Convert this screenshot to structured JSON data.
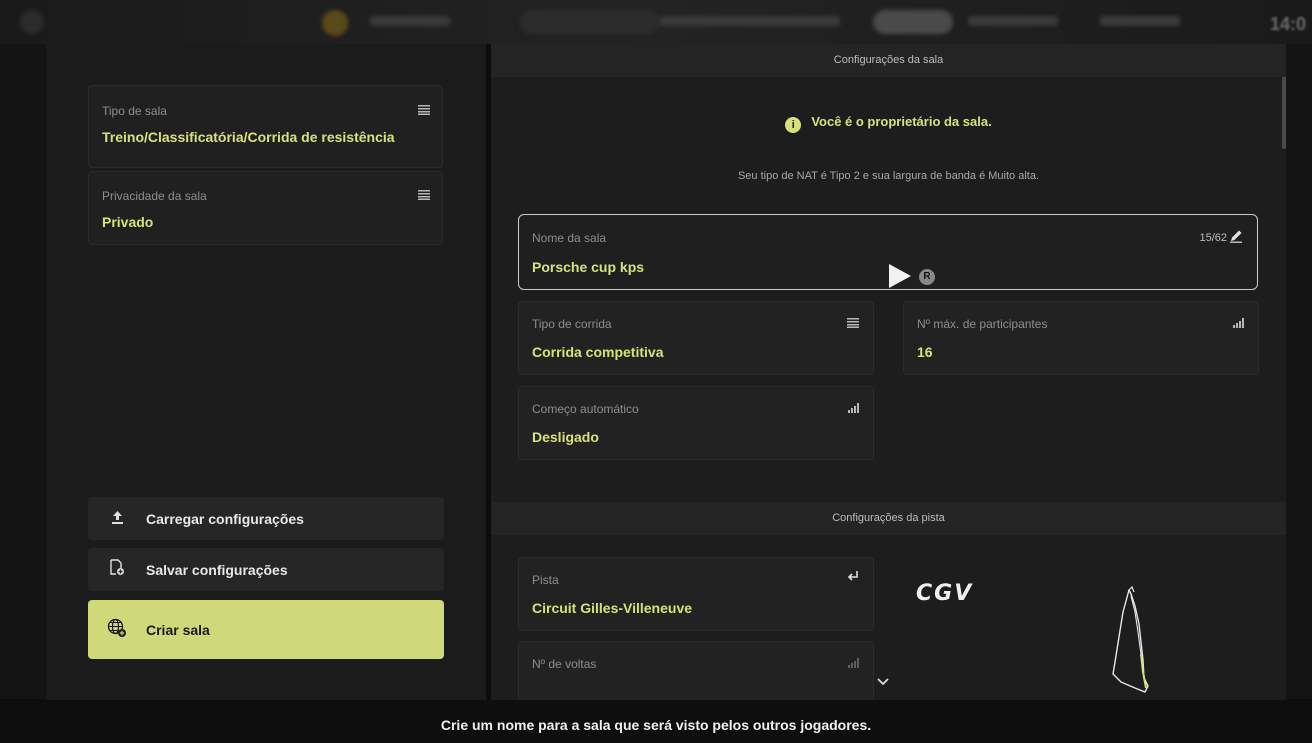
{
  "left": {
    "room_type": {
      "label": "Tipo de sala",
      "value": "Treino/Classificatória/Corrida de resistência",
      "icon": "list-icon"
    },
    "room_privacy": {
      "label": "Privacidade da sala",
      "value": "Privado",
      "icon": "list-icon"
    },
    "actions": {
      "load_label": "Carregar configurações",
      "save_label": "Salvar configurações",
      "create_label": "Criar sala"
    }
  },
  "right": {
    "room_section_title": "Configurações da sala",
    "owner_message": "Você é o proprietário da sala.",
    "nat_message": "Seu tipo de NAT é Tipo 2 e sua largura de banda é Muito alta.",
    "room_name": {
      "label": "Nome da sala",
      "value": "Porsche cup kps",
      "counter": "15/62",
      "icon": "pencil-icon"
    },
    "race_type": {
      "label": "Tipo de corrida",
      "value": "Corrida competitiva",
      "icon": "list-icon"
    },
    "max_participants": {
      "label": "Nº máx. de participantes",
      "value": "16",
      "icon": "signal-icon"
    },
    "auto_start": {
      "label": "Começo automático",
      "value": "Desligado",
      "icon": "signal-icon"
    },
    "track_section_title": "Configurações da pista",
    "track": {
      "label": "Pista",
      "value": "Circuit Gilles-Villeneuve",
      "icon": "return-arrow-icon"
    },
    "laps": {
      "label": "Nº de voltas",
      "icon": "signal-icon"
    },
    "track_logo": "CGV"
  },
  "cursor_badge": "R",
  "hint": "Crie um nome para a sala que será visto pelos outros jogadores.",
  "colors": {
    "accent": "#d8e27a",
    "primary_button": "#cfd97a",
    "panel_bg": "#1d1d1d",
    "card_bg": "#222222"
  }
}
